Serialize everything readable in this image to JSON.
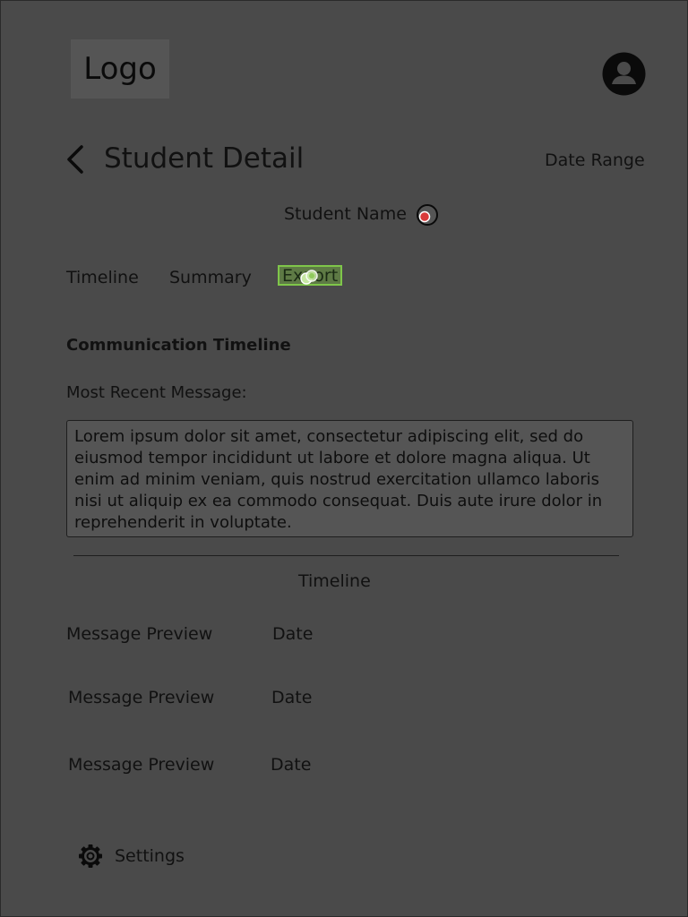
{
  "header": {
    "logo_text": "Logo",
    "avatar_icon": "user-avatar-icon"
  },
  "page": {
    "back_icon": "chevron-left-icon",
    "title": "Student Detail",
    "date_range_label": "Date Range"
  },
  "student": {
    "name_label": "Student Name",
    "status_icon": "radio-indicator-icon",
    "status_color": "#d93a3a"
  },
  "tabs": [
    {
      "label": "Timeline"
    },
    {
      "label": "Summary"
    },
    {
      "label": "Export",
      "highlighted": true
    }
  ],
  "communication": {
    "section_title": "Communication Timeline",
    "recent_label": "Most Recent Message:",
    "recent_message": "Lorem ipsum dolor sit amet, consectetur adipiscing elit, sed do eiusmod tempor incididunt ut labore et dolore magna aliqua. Ut enim ad minim veniam, quis nostrud exercitation ullamco laboris nisi ut aliquip ex ea commodo consequat. Duis aute irure dolor in reprehenderit in voluptate."
  },
  "timeline": {
    "heading": "Timeline",
    "rows": [
      {
        "preview": "Message Preview",
        "date": "Date"
      },
      {
        "preview": "Message Preview",
        "date": "Date"
      },
      {
        "preview": "Message Preview",
        "date": "Date"
      }
    ]
  },
  "footer": {
    "settings_icon": "gear-icon",
    "settings_label": "Settings"
  },
  "colors": {
    "background": "#4a4a4a",
    "highlight_border": "#7fc64a",
    "highlight_fill": "#5e7a45"
  }
}
